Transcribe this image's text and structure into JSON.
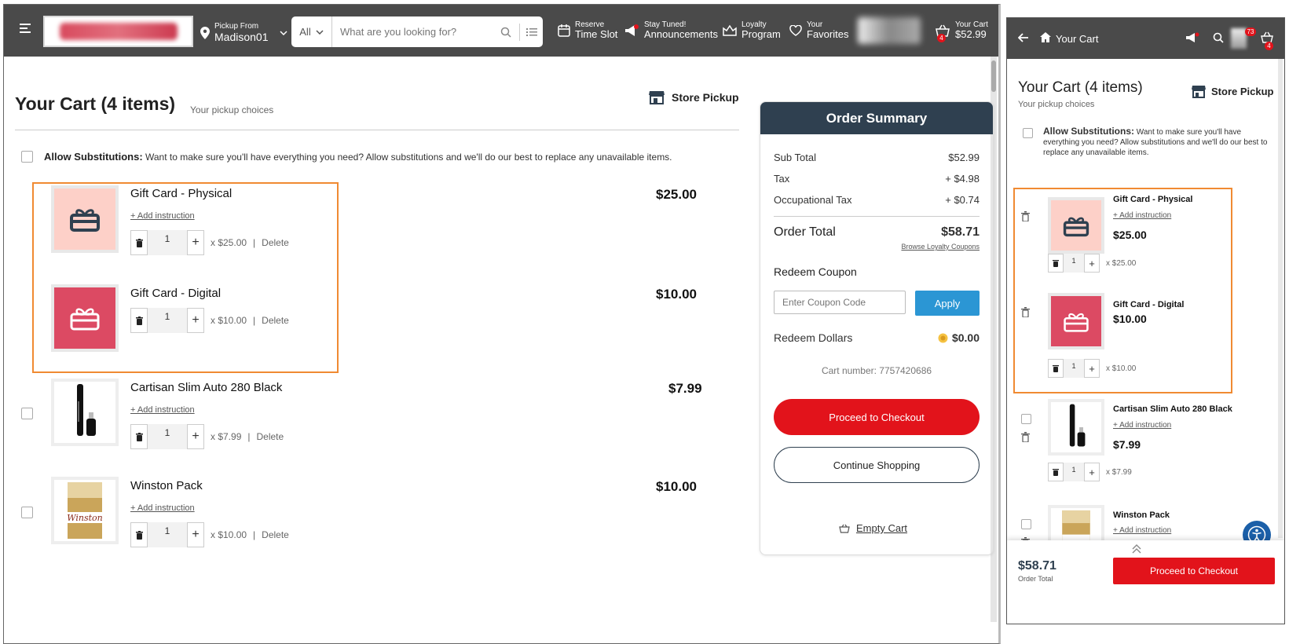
{
  "header": {
    "pickup_from_label": "Pickup From",
    "pickup_location": "Madison01",
    "search_category": "All",
    "search_placeholder": "What are you looking for?",
    "reserve_small": "Reserve",
    "reserve_big": "Time Slot",
    "stay_small": "Stay Tuned!",
    "stay_big": "Announcements",
    "loyalty_small": "Loyalty",
    "loyalty_big": "Program",
    "favorites_small": "Your",
    "favorites_big": "Favorites",
    "cart_small": "Your Cart",
    "cart_total": "$52.99",
    "cart_badge": "4"
  },
  "cart": {
    "title": "Your Cart (4 items)",
    "subtitle": "Your pickup choices",
    "pickup_mode": "Store Pickup",
    "subst_label": "Allow Substitutions:",
    "subst_text": "Want to make sure you'll have everything you need? Allow substitutions and we'll do our best to replace any unavailable items.",
    "add_instruction": "+ Add instruction",
    "delete_label": "Delete",
    "items": [
      {
        "name": "Gift Card - Physical",
        "price": "$25.00",
        "qty": "1",
        "unit": "x $25.00"
      },
      {
        "name": "Gift Card - Digital",
        "price": "$10.00",
        "qty": "1",
        "unit": "x $10.00"
      },
      {
        "name": "Cartisan Slim Auto 280 Black",
        "price": "$7.99",
        "qty": "1",
        "unit": "x $7.99"
      },
      {
        "name": "Winston Pack",
        "price": "$10.00",
        "qty": "1",
        "unit": "x $10.00"
      }
    ]
  },
  "summary": {
    "title": "Order Summary",
    "subtotal_label": "Sub Total",
    "subtotal": "$52.99",
    "tax_label": "Tax",
    "tax": "+ $4.98",
    "occ_label": "Occupational Tax",
    "occ": "+ $0.74",
    "total_label": "Order Total",
    "total": "$58.71",
    "loyalty_coupons": "Browse Loyalty Coupons",
    "redeem_coupon": "Redeem Coupon",
    "coupon_placeholder": "Enter Coupon Code",
    "apply": "Apply",
    "redeem_dollars": "Redeem Dollars",
    "redeem_value": "$0.00",
    "cart_number": "Cart number: 7757420686",
    "proceed": "Proceed to Checkout",
    "continue": "Continue Shopping",
    "empty": "Empty Cart"
  },
  "mobile": {
    "header_title": "Your Cart",
    "notif_badge": "73",
    "cart_badge": "4",
    "title": "Your Cart (4 items)",
    "subtitle": "Your pickup choices",
    "pickup_mode": "Store Pickup",
    "subst_label": "Allow Substitutions:",
    "subst_text": "Want to make sure you'll have everything you need? Allow substitutions and we'll do our best to replace any unavailable items.",
    "add_instruction": "+ Add instruction",
    "total": "$58.71",
    "total_label": "Order Total",
    "proceed": "Proceed to Checkout"
  },
  "colors": {
    "accent_red": "#e2131b",
    "header_bg": "#4a4a4a",
    "summary_head": "#2f4050",
    "highlight": "#f08a32",
    "apply_blue": "#2b96d4"
  }
}
